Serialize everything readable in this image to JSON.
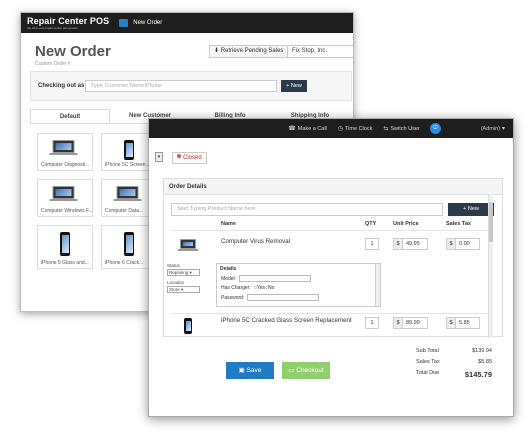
{
  "back_window": {
    "brand": "Repair Center POS",
    "brand_tagline": "the all-in-one repair center pos system",
    "nav_tab": "New Order",
    "title": "New Order",
    "subtitle": "Custom Order #",
    "retrieve_button": "Retrieve Pending Sales",
    "store": "Fix Stop, Inc.",
    "checkout_label": "Checking out as",
    "customer_placeholder": "Type Customer Name/Phone",
    "new_button": "+ New",
    "tabs": [
      "Default",
      "New Customer",
      "Billing Info",
      "Shipping Info"
    ],
    "tiles": [
      {
        "label": "Computer Diagnosti...",
        "icon": "laptop"
      },
      {
        "label": "iPhone 5C Screen...",
        "icon": "phone"
      },
      {
        "label": "Computer Windows F...",
        "icon": "laptop"
      },
      {
        "label": "Computer Data...",
        "icon": "laptop"
      },
      {
        "label": "iPhone 5 Glass and...",
        "icon": "phone"
      },
      {
        "label": "iPhone 6 Crack...",
        "icon": "phone"
      }
    ]
  },
  "front_window": {
    "topbar": {
      "make_call": "Make a Call",
      "time_clock": "Time Clock",
      "switch_user": "Switch User",
      "admin": "(Admin)"
    },
    "status_badge": "Closed",
    "panel_title": "Order Details",
    "search_placeholder": "Start Typing Product Name here",
    "new_button": "New",
    "columns": {
      "name": "Name",
      "qty": "QTY",
      "unit_price": "Unit Price",
      "sales_tax": "Sales Tax"
    },
    "items": [
      {
        "name": "Computer Virus Removal",
        "qty": "1",
        "currency": "$",
        "unit_price": "49.95",
        "tax": "0.00"
      },
      {
        "name": "iPhone 5C Cracked Glass Screen Replacement",
        "qty": "1",
        "currency": "$",
        "unit_price": "89.99",
        "tax": "5.85"
      }
    ],
    "details": {
      "status_label": "Status",
      "status_value": "Repairing",
      "location_label": "Location",
      "location_value": "Store",
      "header": "Details",
      "model_label": "Model:",
      "charger_label": "Has Charger:",
      "charger_yes": "Yes",
      "charger_no": "No",
      "password_label": "Password:"
    },
    "totals": {
      "subtotal_label": "Sub Total",
      "subtotal": "$139.94",
      "tax_label": "Sales Tax",
      "tax": "$5.85",
      "total_label": "Total Due",
      "total": "$145.79"
    },
    "save_button": "Save",
    "checkout_button": "Checkout"
  }
}
